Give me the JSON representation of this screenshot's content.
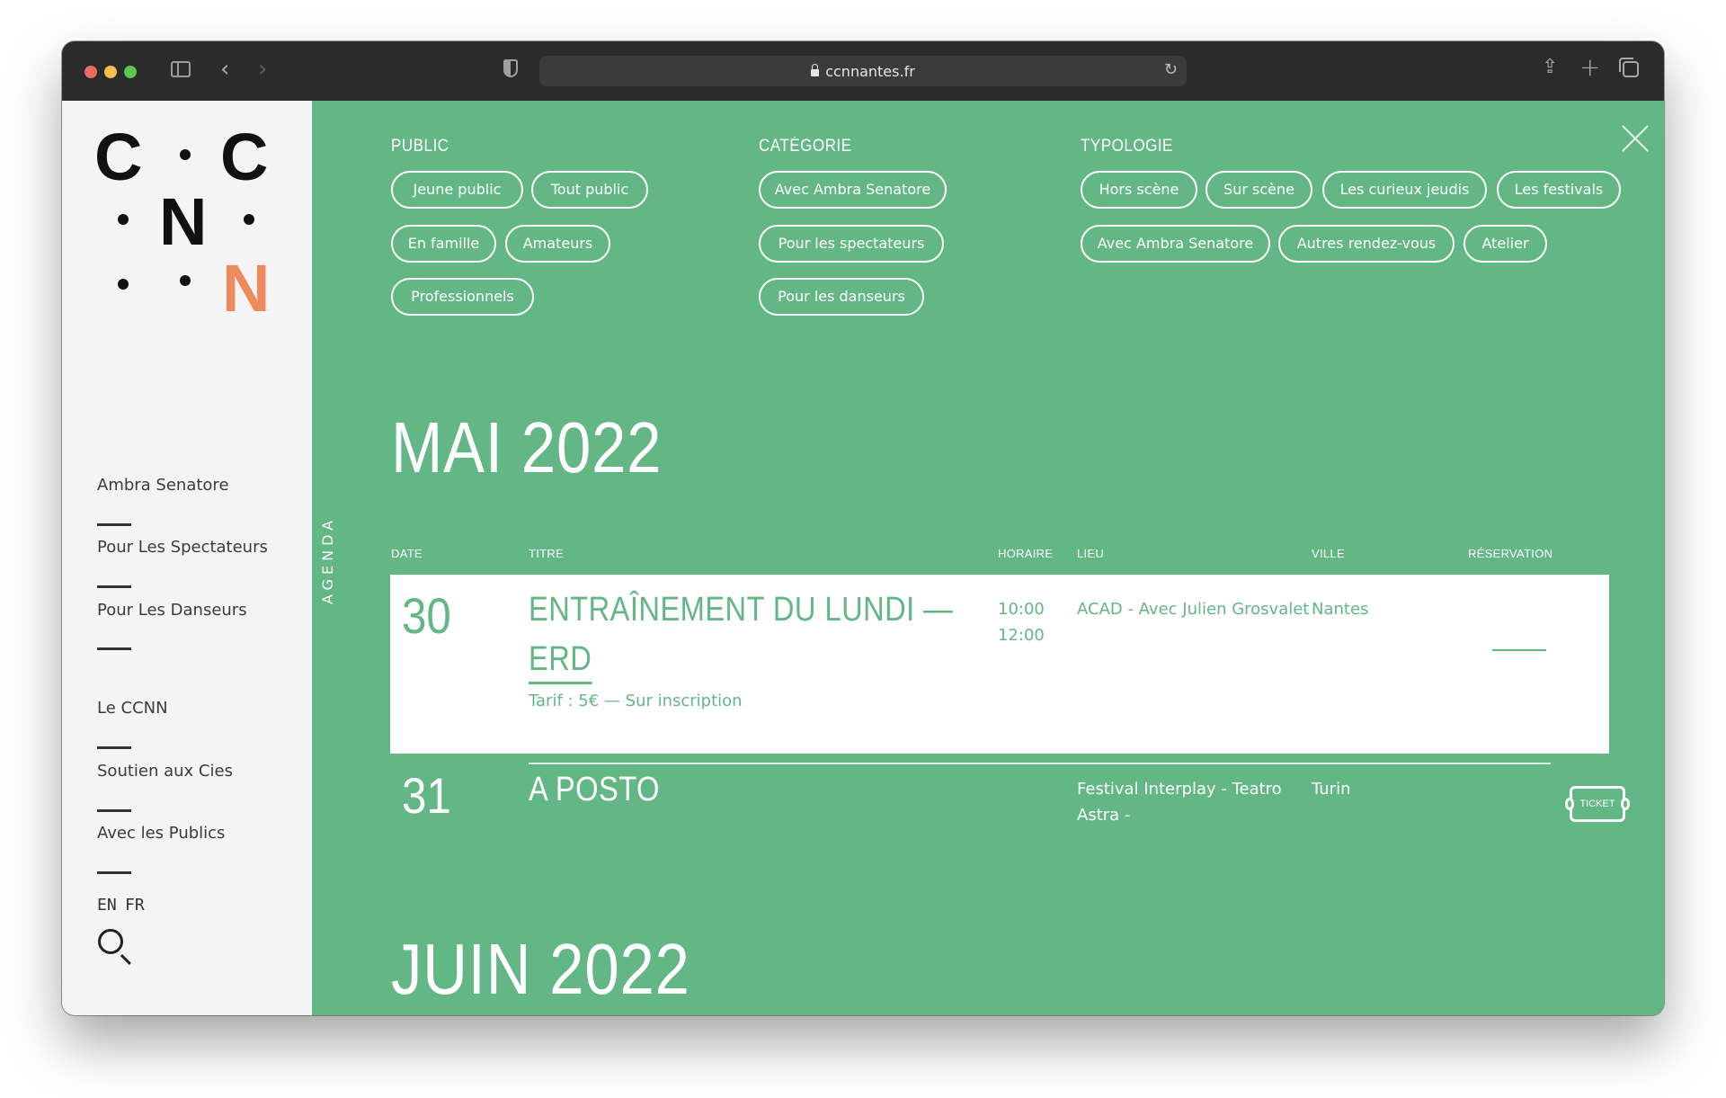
{
  "browser": {
    "url": "ccnnantes.fr"
  },
  "logo": {
    "letters": [
      "C",
      "C",
      "N",
      "N"
    ],
    "accent_color": "#ef8a5d"
  },
  "sidebar": {
    "items": [
      {
        "label": "Ambra Senatore"
      },
      {
        "label": "Pour Les Spectateurs"
      },
      {
        "label": "Pour Les Danseurs"
      },
      {
        "label": "Le CCNN"
      },
      {
        "label": "Soutien aux Cies"
      },
      {
        "label": "Avec les Publics"
      }
    ],
    "lang_en": "EN",
    "lang_fr": "FR"
  },
  "filters": {
    "public": {
      "label": "PUBLIC",
      "chips": [
        "Jeune public",
        "Tout public",
        "En famille",
        "Amateurs",
        "Professionnels"
      ]
    },
    "categorie": {
      "label": "CATÉGORIE",
      "chips": [
        "Avec Ambra Senatore",
        "Pour les spectateurs",
        "Pour les danseurs"
      ]
    },
    "typologie": {
      "label": "TYPOLOGIE",
      "chips": [
        "Hors scène",
        "Sur scène",
        "Les curieux jeudis",
        "Les festivals",
        "Avec Ambra Senatore",
        "Autres rendez-vous",
        "Atelier"
      ]
    }
  },
  "agenda": {
    "side_label": "AGENDA",
    "months": [
      "MAI 2022",
      "JUIN 2022"
    ],
    "columns": [
      "DATE",
      "TITRE",
      "HORAIRE",
      "LIEU",
      "VILLE",
      "RÉSERVATION"
    ],
    "events": [
      {
        "day": "30",
        "title_line1": "ENTRAÎNEMENT DU LUNDI —",
        "title_line2": "ERD",
        "subtitle": "Tarif : 5€ — Sur inscription",
        "time_start": "10:00",
        "time_end": "12:00",
        "venue": "ACAD - Avec Julien Grosvalet",
        "city": "Nantes"
      },
      {
        "day": "31",
        "title": "A POSTO",
        "venue_line1": "Festival Interplay - Teatro",
        "venue_line2": "Astra -",
        "city": "Turin",
        "ticket_label": "TICKET"
      }
    ]
  },
  "colors": {
    "green": "#63b785",
    "sidebar_bg": "#f4f4f4"
  }
}
